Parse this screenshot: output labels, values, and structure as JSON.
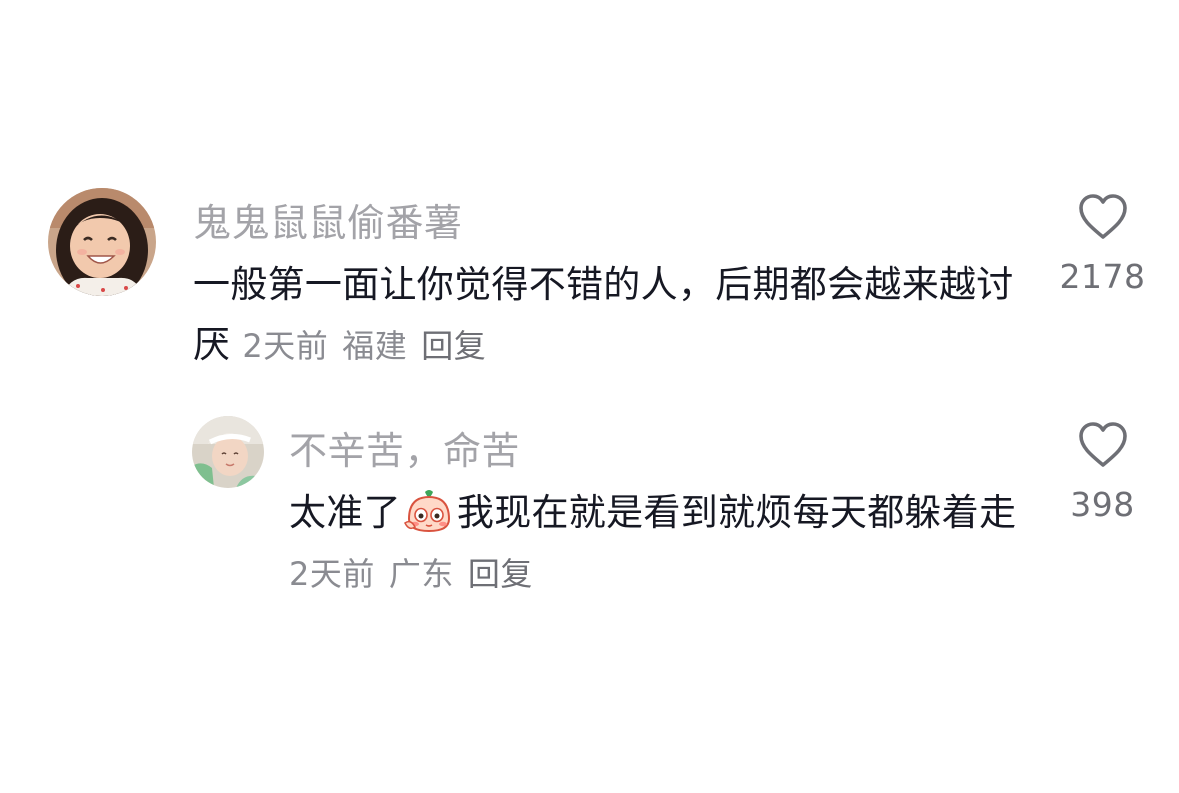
{
  "comments": [
    {
      "username": "鬼鬼鼠鼠偷番薯",
      "avatar_icon": "avatar-girl-smiling",
      "text": "一般第一面让你觉得不错的人，后期都会越来越讨厌",
      "time": "2天前",
      "location": "福建",
      "reply_label": "回复",
      "like_icon": "heart-outline-icon",
      "likes": "2178"
    },
    {
      "username": "不辛苦，命苦",
      "avatar_icon": "avatar-person-headband",
      "text_before_emoji": "太准了",
      "emoji": "shy-blushing-emoji",
      "text_after_emoji": "我现在就是看到就烦每天都躲着走",
      "time": "2天前",
      "location": "广东",
      "reply_label": "回复",
      "like_icon": "heart-outline-icon",
      "likes": "398"
    }
  ],
  "colors": {
    "username": "#a3a3a8",
    "text": "#161823",
    "meta": "#8a8b91",
    "icon": "#6e6f75",
    "background": "#ffffff"
  }
}
